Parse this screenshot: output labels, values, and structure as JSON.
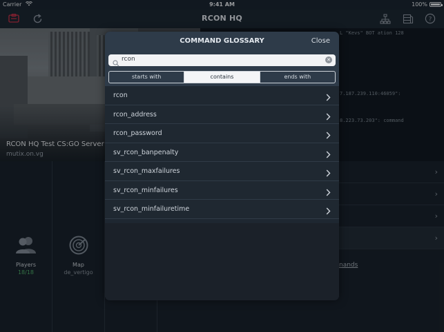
{
  "status_bar": {
    "carrier": "Carrier",
    "time": "9:41 AM",
    "battery": "100%"
  },
  "navbar": {
    "title": "RCON HQ",
    "left_icons": [
      "power-icon",
      "refresh-icon"
    ],
    "right_icons": [
      "network-icon",
      "server-rack-icon",
      "help-icon"
    ],
    "accent_color": "#c8324a"
  },
  "server": {
    "name": "RCON HQ Test CS:GO Server",
    "host": "mutix.on.vg"
  },
  "console": {
    "lines": [
      {
        "text": "L \"Kevs\" BOT  ation 128"
      },
      {
        "text": "7.187.239.110:46059\":"
      },
      {
        "text": "8.223.73.203\": command"
      }
    ]
  },
  "tiles": [
    {
      "label": "Players",
      "sub": "18/18",
      "icon": "players-icon",
      "sub_color": "#4fae6a"
    },
    {
      "label": "Map",
      "sub": "de_vertigo",
      "icon": "map-radar-icon",
      "sub_color": "#8a949e"
    }
  ],
  "right_rows_count": 4,
  "commands_link": "nands",
  "glossary": {
    "title": "COMMAND GLOSSARY",
    "close_label": "Close",
    "search_value": "rcon",
    "segments": [
      "starts with",
      "contains",
      "ends with"
    ],
    "active_segment": "contains",
    "commands": [
      "rcon",
      "rcon_address",
      "rcon_password",
      "sv_rcon_banpenalty",
      "sv_rcon_maxfailures",
      "sv_rcon_minfailures",
      "sv_rcon_minfailuretime"
    ]
  }
}
